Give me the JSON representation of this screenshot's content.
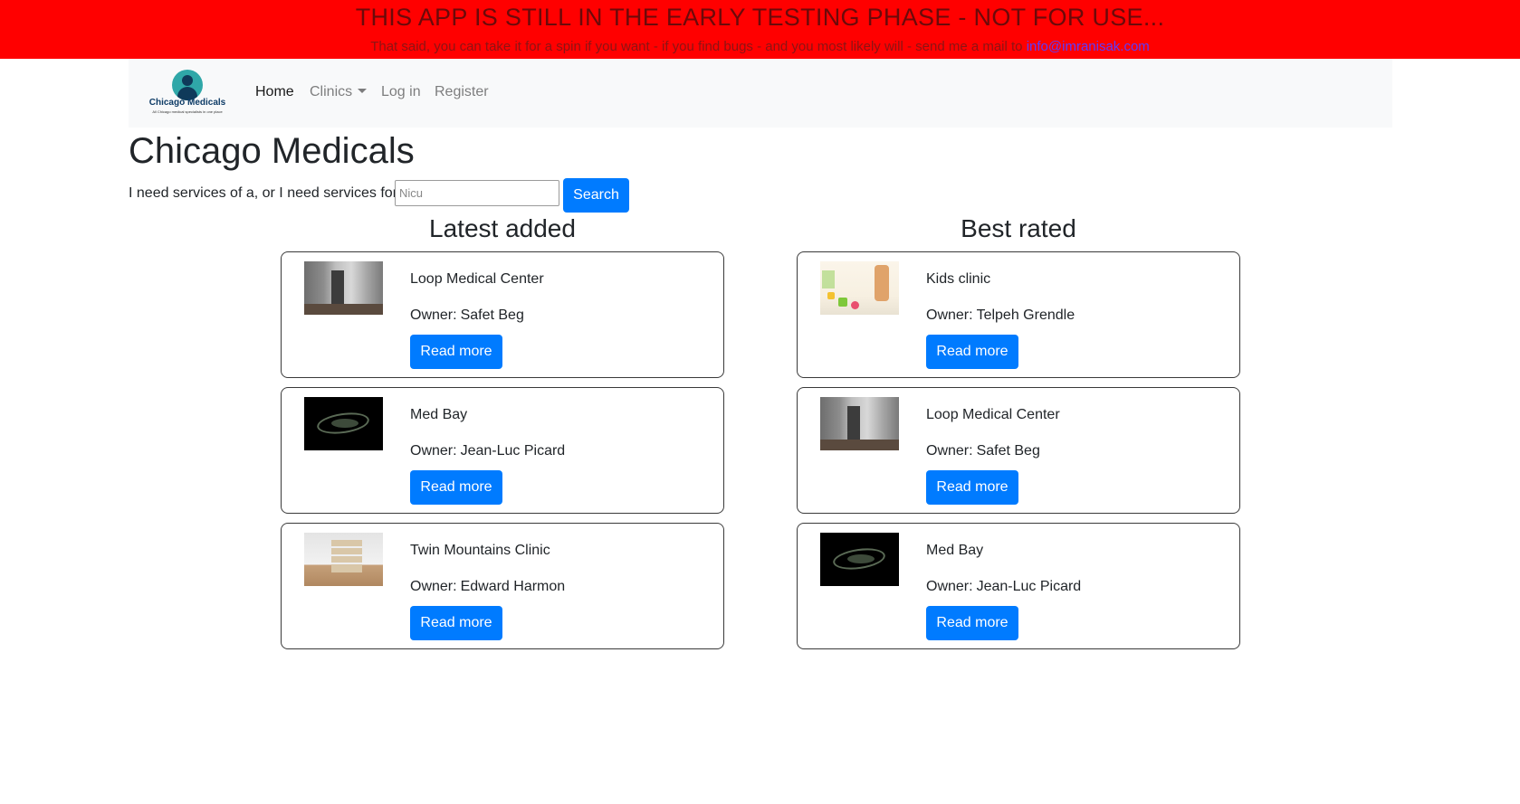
{
  "banner": {
    "title": "THIS APP IS STILL IN THE EARLY TESTING PHASE - NOT FOR USE...",
    "subtitle": "That said, you can take it for a spin if you want - if you find bugs - and you most likely will - send me a mail to",
    "email": "info@imranisak.com",
    "background_color": "#ff0000"
  },
  "navbar": {
    "logo": {
      "text": "Chicago Medicals",
      "tagline": "All Chicago medical specialists in one place",
      "icon": "person-in-circle-logo"
    },
    "links": [
      {
        "label": "Home",
        "active": true
      },
      {
        "label": "Clinics",
        "dropdown": true
      },
      {
        "label": "Log in"
      },
      {
        "label": "Register"
      }
    ]
  },
  "main": {
    "title": "Chicago Medicals",
    "search": {
      "label": "I need services of a, or I need services for",
      "placeholder": "Nicu",
      "value": "",
      "button_label": "Search"
    },
    "latest": {
      "heading": "Latest added",
      "cards": [
        {
          "name": "Loop Medical Center",
          "owner_prefix": "Owner:",
          "owner": "Safet Beg",
          "button": "Read more",
          "thumbnail": "hallway-image"
        },
        {
          "name": "Med Bay",
          "owner_prefix": "Owner:",
          "owner": "Jean-Luc Picard",
          "button": "Read more",
          "thumbnail": "spaceship-image"
        },
        {
          "name": "Twin Mountains Clinic",
          "owner_prefix": "Owner:",
          "owner": "Edward Harmon",
          "button": "Read more",
          "thumbnail": "room-image"
        }
      ]
    },
    "best": {
      "heading": "Best rated",
      "cards": [
        {
          "name": "Kids clinic",
          "owner_prefix": "Owner:",
          "owner": "Telpeh Grendle",
          "button": "Read more",
          "thumbnail": "kids-room-image"
        },
        {
          "name": "Loop Medical Center",
          "owner_prefix": "Owner:",
          "owner": "Safet Beg",
          "button": "Read more",
          "thumbnail": "hallway-image"
        },
        {
          "name": "Med Bay",
          "owner_prefix": "Owner:",
          "owner": "Jean-Luc Picard",
          "button": "Read more",
          "thumbnail": "spaceship-image"
        }
      ]
    }
  },
  "colors": {
    "primary_button": "#007bff",
    "navbar_bg": "#f8f9fa",
    "link": "#5b3cff"
  }
}
